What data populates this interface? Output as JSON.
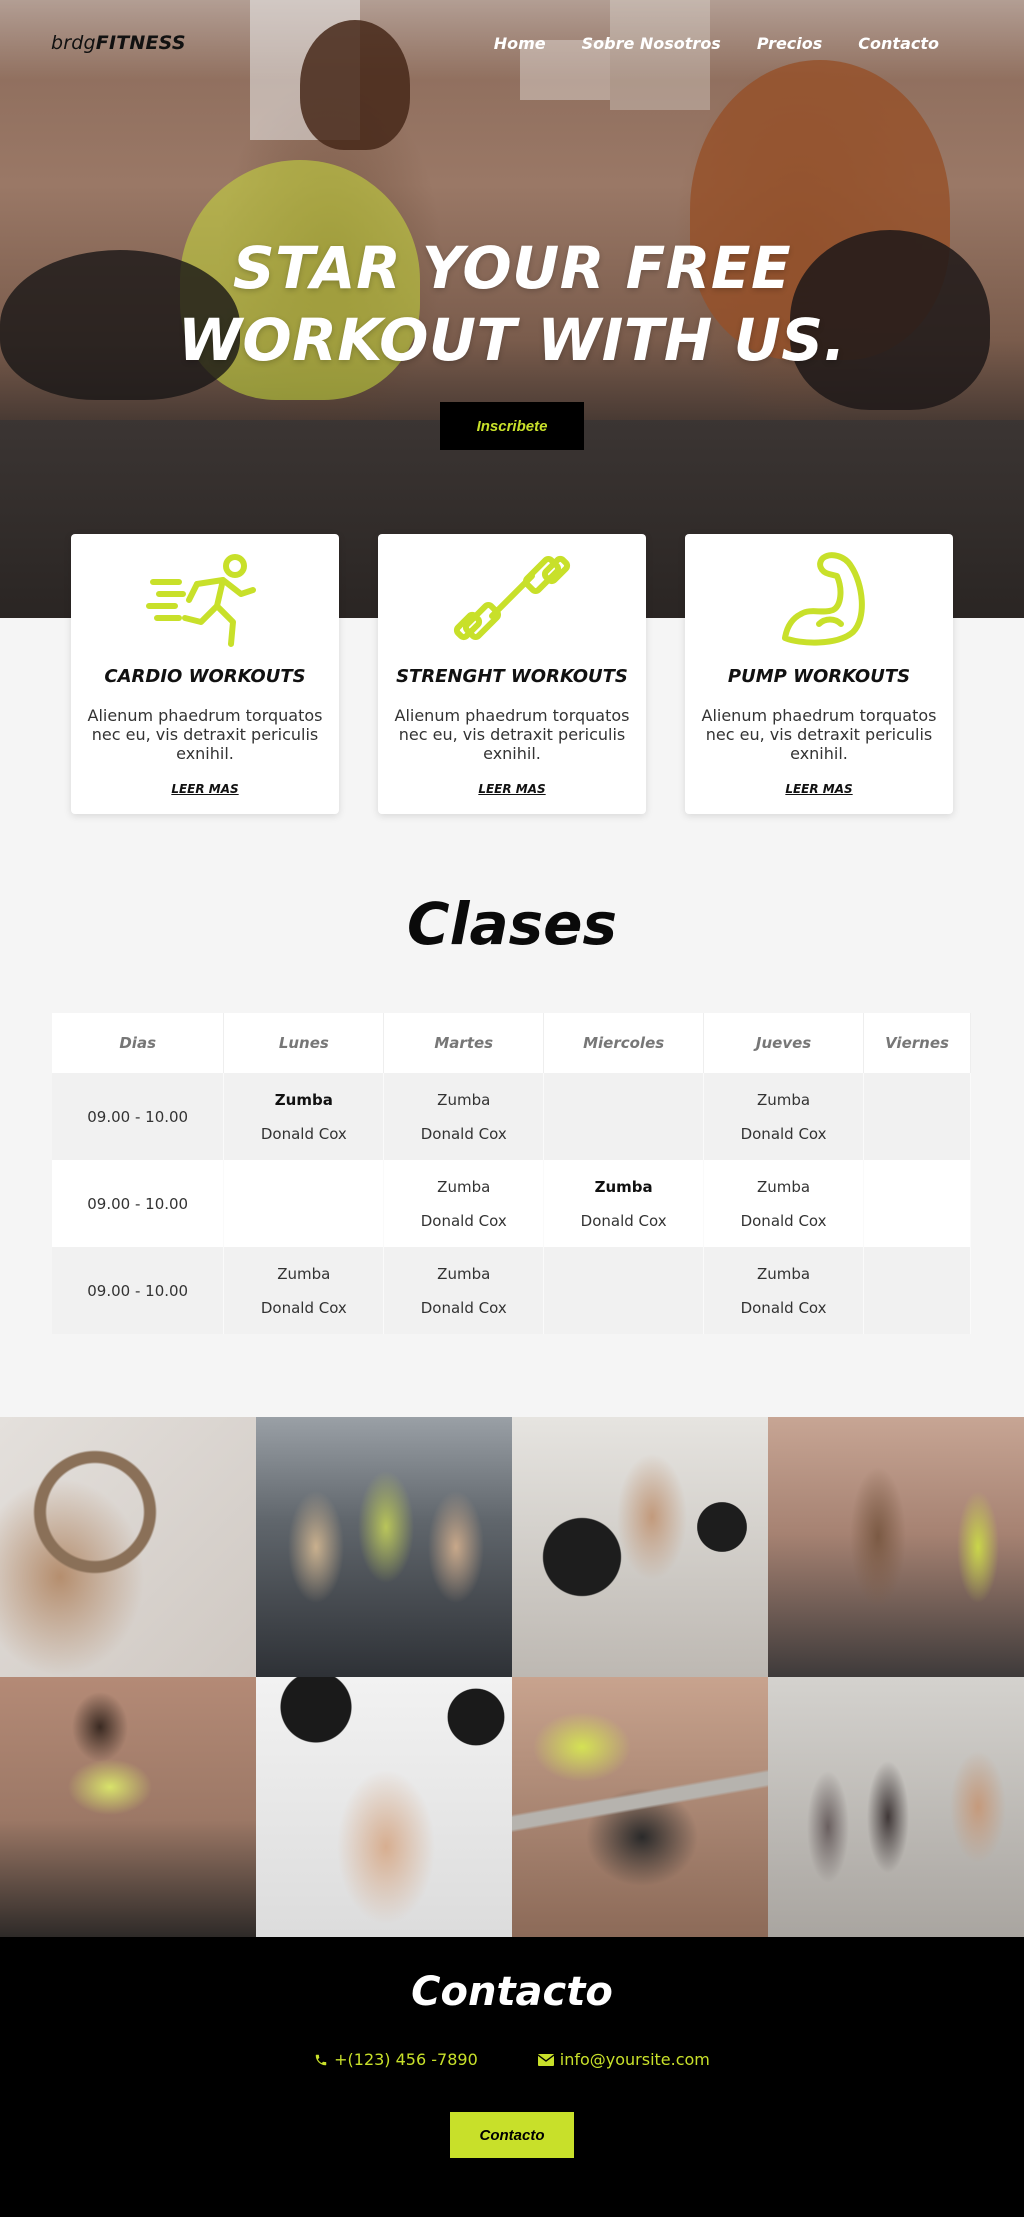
{
  "brand": {
    "prefix": "brdg",
    "name": "FITNESS"
  },
  "nav": [
    "Home",
    "Sobre Nosotros",
    "Precios",
    "Contacto"
  ],
  "hero": {
    "title_line1": "STAR YOUR FREE",
    "title_line2": "WORKOUT WITH US.",
    "cta": "Inscribete"
  },
  "accent": "#c8e02a",
  "features": [
    {
      "icon": "runner-icon",
      "title": "CARDIO WORKOUTS",
      "text": "Alienum phaedrum torquatos nec eu, vis detraxit periculis exnihil.",
      "link": "LEER MAS"
    },
    {
      "icon": "dumbbell-icon",
      "title": "STRENGHT WORKOUTS",
      "text": "Alienum phaedrum torquatos nec eu, vis detraxit periculis exnihil.",
      "link": "LEER MAS"
    },
    {
      "icon": "bicep-icon",
      "title": "PUMP WORKOUTS",
      "text": "Alienum phaedrum torquatos nec eu, vis detraxit periculis exnihil.",
      "link": "LEER MAS"
    }
  ],
  "clases": {
    "title": "Clases",
    "headers": [
      "Dias",
      "Lunes",
      "Martes",
      "Miercoles",
      "Jueves",
      "Viernes"
    ],
    "rows": [
      {
        "time": "09.00 - 10.00",
        "cells": [
          {
            "cls": "Zumba",
            "inst": "Donald Cox",
            "bold": true
          },
          {
            "cls": "Zumba",
            "inst": "Donald Cox",
            "bold": false
          },
          null,
          {
            "cls": "Zumba",
            "inst": "Donald Cox",
            "bold": false
          },
          null
        ]
      },
      {
        "time": "09.00 - 10.00",
        "cells": [
          null,
          {
            "cls": "Zumba",
            "inst": "Donald Cox",
            "bold": false
          },
          {
            "cls": "Zumba",
            "inst": "Donald Cox",
            "bold": true
          },
          {
            "cls": "Zumba",
            "inst": "Donald Cox",
            "bold": false
          },
          null
        ]
      },
      {
        "time": "09.00 - 10.00",
        "cells": [
          {
            "cls": "Zumba",
            "inst": "Donald Cox",
            "bold": false
          },
          {
            "cls": "Zumba",
            "inst": "Donald Cox",
            "bold": false
          },
          null,
          {
            "cls": "Zumba",
            "inst": "Donald Cox",
            "bold": false
          },
          null
        ]
      }
    ]
  },
  "contact": {
    "title": "Contacto",
    "phone": "+(123) 456 -7890",
    "email": "info@yoursite.com",
    "button": "Contacto"
  }
}
